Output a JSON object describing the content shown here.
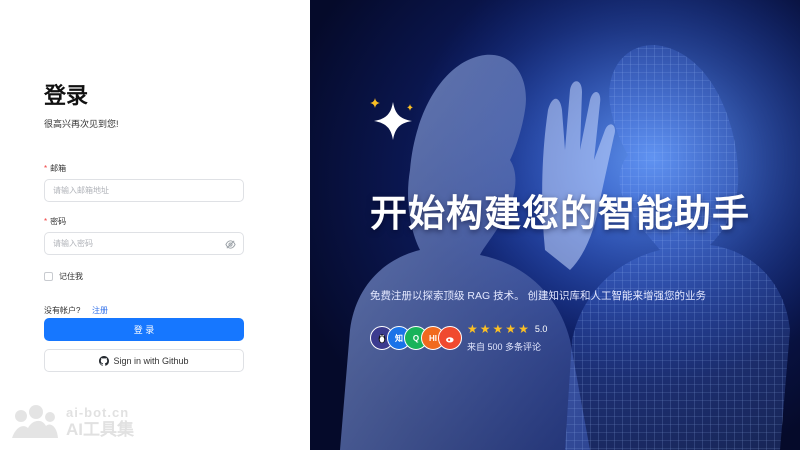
{
  "login": {
    "title": "登录",
    "subtitle": "很高兴再次见到您!",
    "email": {
      "required_mark": "*",
      "label": "邮箱",
      "placeholder": "请输入邮箱地址"
    },
    "password": {
      "required_mark": "*",
      "label": "密码",
      "placeholder": "请输入密码",
      "toggle_icon": "eye-off-icon"
    },
    "remember_label": "记住我",
    "no_account_text": "没有帐户?",
    "register_link": "注册",
    "login_button": "登 录",
    "github_button": "Sign in with Github",
    "github_icon": "github-icon"
  },
  "hero": {
    "title": "开始构建您的智能助手",
    "description": "免费注册以探索顶级 RAG 技术。 创建知识库和人工智能来增强您的业务",
    "avatars": [
      {
        "label": "",
        "color": "#3b3b8f"
      },
      {
        "label": "知",
        "color": "#1a73e8"
      },
      {
        "label": "Q",
        "color": "#19b35a"
      },
      {
        "label": "HI",
        "color": "#f16a1f"
      },
      {
        "label": "",
        "color": "#f04a2f"
      }
    ],
    "rating": {
      "stars": 5,
      "score": "5.0"
    },
    "reviews": "来自 500 多条评论"
  },
  "watermark": {
    "line1": "ai-bot.cn",
    "line2": "AI工具集"
  },
  "colors": {
    "primary": "#1677ff",
    "star": "#fbbf24",
    "required": "#f04040",
    "link": "#2f6fea"
  }
}
